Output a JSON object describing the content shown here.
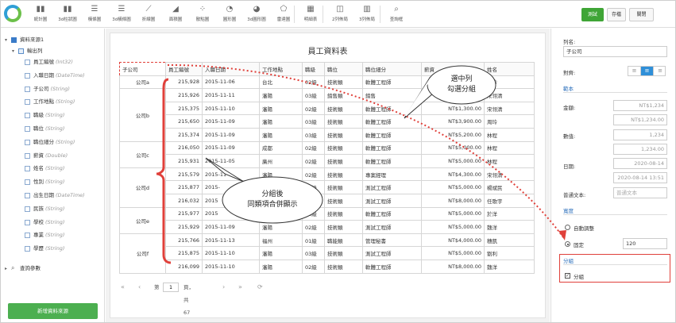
{
  "toolbar": {
    "items": [
      {
        "label": "統計圖",
        "icon": "bar-chart-icon"
      },
      {
        "label": "3d柱狀圖",
        "icon": "3d-bar-chart-icon"
      },
      {
        "label": "橫條圖",
        "icon": "horizontal-bar-icon"
      },
      {
        "label": "3d橫條圖",
        "icon": "3d-horizontal-bar-icon"
      },
      {
        "label": "折線圖",
        "icon": "line-chart-icon"
      },
      {
        "label": "面積圖",
        "icon": "area-chart-icon"
      },
      {
        "label": "散點圖",
        "icon": "scatter-chart-icon"
      },
      {
        "label": "圓形圖",
        "icon": "pie-chart-icon"
      },
      {
        "label": "3d圓形圖",
        "icon": "3d-pie-chart-icon"
      },
      {
        "label": "雷達圖",
        "icon": "radar-chart-icon"
      },
      {
        "label": "明細表",
        "icon": "detail-table-icon"
      },
      {
        "label": "2列佈局",
        "icon": "two-column-layout-icon"
      },
      {
        "label": "3列佈局",
        "icon": "three-column-layout-icon"
      },
      {
        "label": "查詢框",
        "icon": "query-box-icon"
      }
    ],
    "test_label": "測試",
    "save_label": "存檔",
    "close_label": "關閉"
  },
  "left": {
    "root_label": "資料來源1",
    "output_label": "輸出列",
    "fields": [
      {
        "name": "員工編號",
        "type": "(Int32)"
      },
      {
        "name": "入職日期",
        "type": "(DateTime)"
      },
      {
        "name": "子公司",
        "type": "(String)"
      },
      {
        "name": "工作地點",
        "type": "(String)"
      },
      {
        "name": "職級",
        "type": "(String)"
      },
      {
        "name": "職位",
        "type": "(String)"
      },
      {
        "name": "職位細分",
        "type": "(String)"
      },
      {
        "name": "薪資",
        "type": "(Double)"
      },
      {
        "name": "姓名",
        "type": "(String)"
      },
      {
        "name": "性別",
        "type": "(String)"
      },
      {
        "name": "出生日期",
        "type": "(DateTime)"
      },
      {
        "name": "民族",
        "type": "(String)"
      },
      {
        "name": "學校",
        "type": "(String)"
      },
      {
        "name": "專業",
        "type": "(String)"
      },
      {
        "name": "學歷",
        "type": "(String)"
      }
    ],
    "query_label": "查詢參數",
    "new_source_label": "新增資料來源"
  },
  "report": {
    "title": "員工資料表",
    "headers": [
      "子公司",
      "員工編號",
      "入職日期",
      "工作地點",
      "職級",
      "職位",
      "職位細分",
      "薪資",
      "姓名"
    ],
    "groups": [
      {
        "name": "公司a",
        "rows": [
          [
            "215,928",
            "2015-11-06",
            "台北",
            "02級",
            "技術類",
            "軟體工程師",
            "",
            "周玲"
          ]
        ]
      },
      {
        "name": "公司b",
        "rows": [
          [
            "215,926",
            "2015-11-11",
            "瀋陽",
            "03級",
            "銷售類",
            "銷售",
            "",
            "宋翎清"
          ],
          [
            "215,375",
            "2015-11-10",
            "瀋陽",
            "02級",
            "技術類",
            "軟體工程師",
            "NT$1,300.00",
            "宋翎清"
          ],
          [
            "215,650",
            "2015-11-09",
            "瀋陽",
            "03級",
            "技術類",
            "軟體工程師",
            "NT$3,900.00",
            "周玲"
          ],
          [
            "215,374",
            "2015-11-09",
            "瀋陽",
            "03級",
            "技術類",
            "軟體工程師",
            "NT$5,200.00",
            "林程"
          ]
        ]
      },
      {
        "name": "公司c",
        "rows": [
          [
            "216,050",
            "2015-11-09",
            "成都",
            "02級",
            "技術類",
            "軟體工程師",
            "NT$5,000.00",
            "林程"
          ],
          [
            "215,931",
            "2015-11-05",
            "廣州",
            "02級",
            "技術類",
            "軟體工程師",
            "NT$5,000.00",
            "林程"
          ]
        ]
      },
      {
        "name": "公司d",
        "rows": [
          [
            "215,579",
            "2015-11-",
            "瀋陽",
            "02級",
            "技術類",
            "專案經理",
            "NT$4,300.00",
            "宋翎清"
          ],
          [
            "215,877",
            "2015-",
            "瀋陽",
            "02級",
            "技術類",
            "測試工程師",
            "NT$5,000.00",
            "楊斌民"
          ],
          [
            "216,032",
            "2015",
            "瀋陽",
            "03級",
            "技術類",
            "測試工程師",
            "NT$8,000.00",
            "任歌宇"
          ]
        ]
      },
      {
        "name": "公司e",
        "rows": [
          [
            "215,977",
            "2015",
            "瀋陽",
            "03級",
            "技術類",
            "軟體工程師",
            "NT$5,000.00",
            "於洋"
          ],
          [
            "215,929",
            "2015-11-09",
            "瀋陽",
            "02級",
            "技術類",
            "測試工程師",
            "NT$5,000.00",
            "魏洋"
          ]
        ]
      },
      {
        "name": "公司f",
        "rows": [
          [
            "215,766",
            "2015-11-13",
            "福州",
            "01級",
            "職能類",
            "管理秘書",
            "NT$4,000.00",
            "穗凱"
          ],
          [
            "215,875",
            "2015-11-10",
            "瀋陽",
            "03級",
            "技術類",
            "測試工程師",
            "NT$5,000.00",
            "劉利"
          ],
          [
            "216,099",
            "2015-11-10",
            "瀋陽",
            "02級",
            "技術類",
            "軟體工程師",
            "NT$8,000.00",
            "魏洋"
          ]
        ]
      }
    ],
    "pager": {
      "page_prefix": "第",
      "page_value": "1",
      "page_suffix": "頁，共67頁"
    }
  },
  "props": {
    "name_label": "列名:",
    "name_value": "子公司",
    "align_label": "對齊:",
    "format_section": "範本",
    "amount_label": "金額:",
    "amount_values": [
      "NT$1,234",
      "NT$1,234.00"
    ],
    "number_label": "數值:",
    "number_values": [
      "1,234",
      "1,234.00"
    ],
    "date_label": "日期:",
    "date_values": [
      "2020-08-14",
      "2020-08-14 13:51"
    ],
    "text_label": "普通文本:",
    "text_placeholder": "普通文本",
    "width_section": "寬度",
    "auto_label": "自動調整",
    "fixed_label": "固定",
    "fixed_value": "120",
    "group_section": "分組",
    "group_check_label": "分組"
  },
  "callouts": {
    "top": [
      "選中列",
      "勾選分組"
    ],
    "bottom": [
      "分組後",
      "同類項合併顯示"
    ]
  },
  "colors": {
    "accent": "#2f8fd8",
    "green": "#4caf50",
    "annotation": "#e0403a"
  }
}
